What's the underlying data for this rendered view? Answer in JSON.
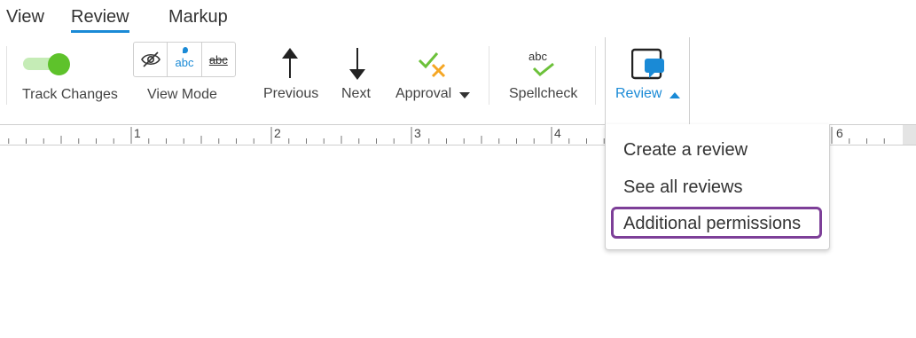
{
  "tabs": [
    {
      "label": "View"
    },
    {
      "label": "Review",
      "active": true
    },
    {
      "label": "Markup"
    }
  ],
  "ribbon": {
    "track_changes": {
      "label": "Track Changes",
      "on": true
    },
    "view_mode": {
      "label": "View Mode",
      "buttons": [
        "hide-markup-icon",
        "simple-markup-icon",
        "all-markup-icon"
      ],
      "simple_text": "abc",
      "all_text": "abc"
    },
    "previous": {
      "label": "Previous",
      "icon": "arrow-up-icon"
    },
    "next": {
      "label": "Next",
      "icon": "arrow-down-icon"
    },
    "approval": {
      "label": "Approval",
      "icon": "approval-icon"
    },
    "spellcheck": {
      "label": "Spellcheck",
      "icon_text": "abc"
    },
    "review": {
      "label": "Review",
      "icon": "review-icon",
      "expanded": true
    }
  },
  "ruler": {
    "numbers": [
      "1",
      "2",
      "3",
      "4",
      "6"
    ]
  },
  "dropdown": {
    "items": [
      {
        "label": "Create a review"
      },
      {
        "label": "See all reviews"
      },
      {
        "label": "Additional permissions",
        "selected": true
      }
    ]
  },
  "colors": {
    "accent": "#1a8ad6",
    "toggle_on": "#5ec22b",
    "highlight": "#7d3f98",
    "approve_green": "#6cc13a",
    "approve_orange": "#f5a623"
  }
}
